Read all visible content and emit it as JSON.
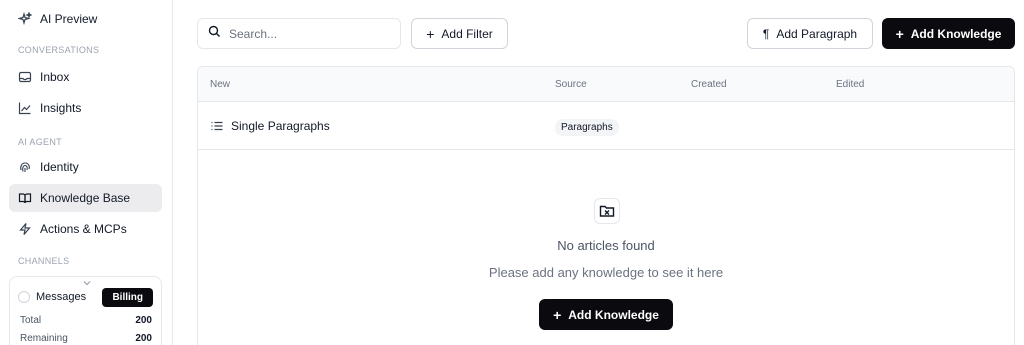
{
  "sidebar": {
    "ai_preview": "AI Preview",
    "section_conversations": "CONVERSATIONS",
    "inbox": "Inbox",
    "insights": "Insights",
    "section_ai_agent": "AI AGENT",
    "identity": "Identity",
    "knowledge_base": "Knowledge Base",
    "actions_mcps": "Actions & MCPs",
    "section_channels": "CHANNELS",
    "usage": {
      "label": "Messages",
      "billing": "Billing",
      "total_label": "Total",
      "total_value": "200",
      "remaining_label": "Remaining",
      "remaining_value": "200"
    }
  },
  "toolbar": {
    "search_placeholder": "Search...",
    "add_filter": "Add Filter",
    "add_paragraph": "Add Paragraph",
    "add_knowledge": "Add Knowledge"
  },
  "table": {
    "columns": [
      "New",
      "Source",
      "Created",
      "Edited"
    ],
    "rows": [
      {
        "name": "Single Paragraphs",
        "source": "Paragraphs",
        "created": "",
        "edited": ""
      }
    ]
  },
  "empty_state": {
    "title": "No articles found",
    "subtitle": "Please add any knowledge to see it here",
    "button": "Add Knowledge"
  },
  "colors": {
    "accent_dark": "#0b0b0f",
    "active_bg": "#ececee",
    "border": "#e5e7eb"
  }
}
